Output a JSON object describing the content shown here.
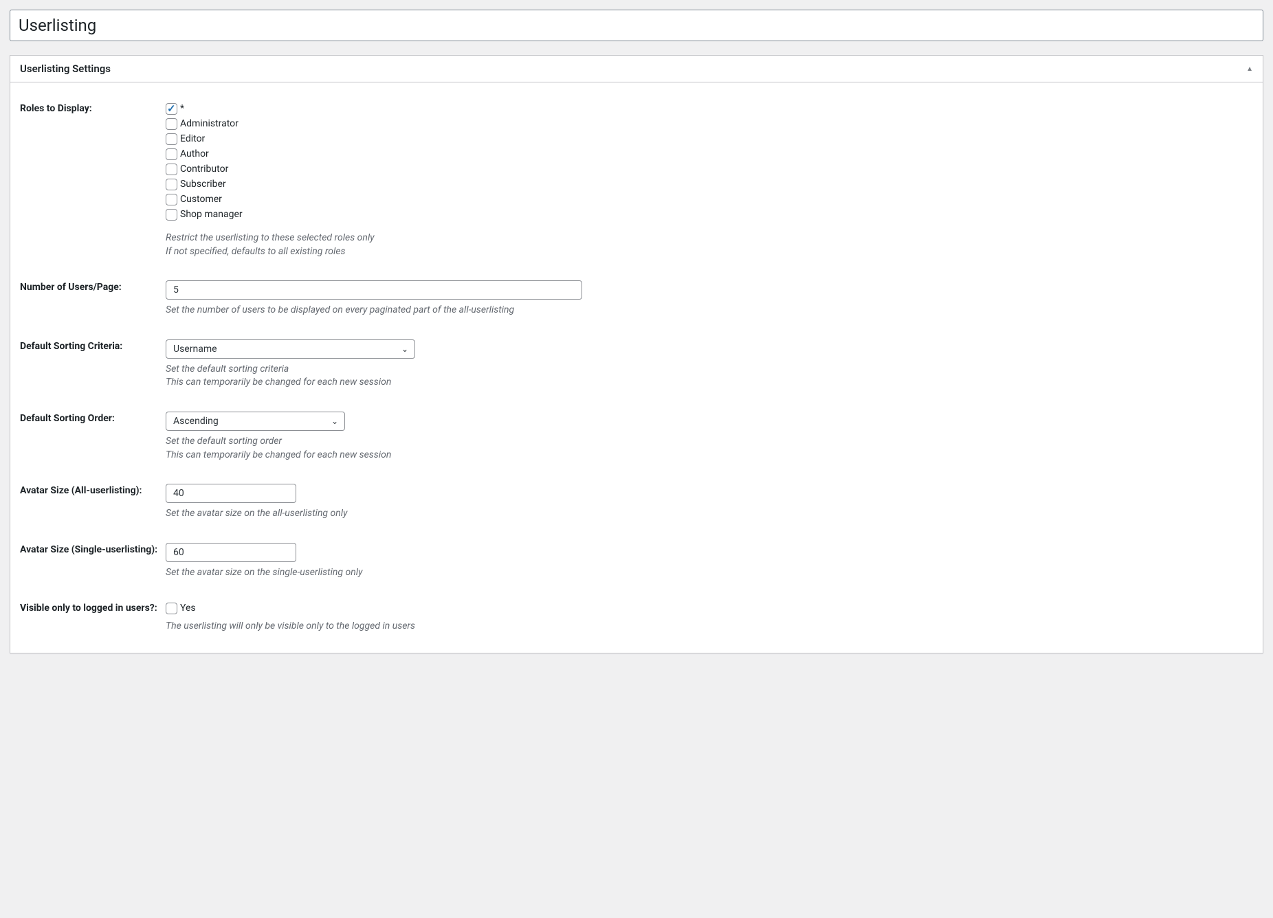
{
  "title": "Userlisting",
  "panel": {
    "heading": "Userlisting Settings"
  },
  "fields": {
    "roles": {
      "label": "Roles to Display:",
      "options": [
        {
          "label": "*",
          "checked": true
        },
        {
          "label": "Administrator",
          "checked": false
        },
        {
          "label": "Editor",
          "checked": false
        },
        {
          "label": "Author",
          "checked": false
        },
        {
          "label": "Contributor",
          "checked": false
        },
        {
          "label": "Subscriber",
          "checked": false
        },
        {
          "label": "Customer",
          "checked": false
        },
        {
          "label": "Shop manager",
          "checked": false
        }
      ],
      "desc1": "Restrict the userlisting to these selected roles only",
      "desc2": "If not specified, defaults to all existing roles"
    },
    "users_per_page": {
      "label": "Number of Users/Page:",
      "value": "5",
      "desc": "Set the number of users to be displayed on every paginated part of the all-userlisting"
    },
    "sort_criteria": {
      "label": "Default Sorting Criteria:",
      "value": "Username",
      "desc1": "Set the default sorting criteria",
      "desc2": "This can temporarily be changed for each new session"
    },
    "sort_order": {
      "label": "Default Sorting Order:",
      "value": "Ascending",
      "desc1": "Set the default sorting order",
      "desc2": "This can temporarily be changed for each new session"
    },
    "avatar_all": {
      "label": "Avatar Size (All-userlisting):",
      "value": "40",
      "desc": "Set the avatar size on the all-userlisting only"
    },
    "avatar_single": {
      "label": "Avatar Size (Single-userlisting):",
      "value": "60",
      "desc": "Set the avatar size on the single-userlisting only"
    },
    "visible_logged": {
      "label": "Visible only to logged in users?:",
      "option_label": "Yes",
      "checked": false,
      "desc": "The userlisting will only be visible only to the logged in users"
    }
  }
}
